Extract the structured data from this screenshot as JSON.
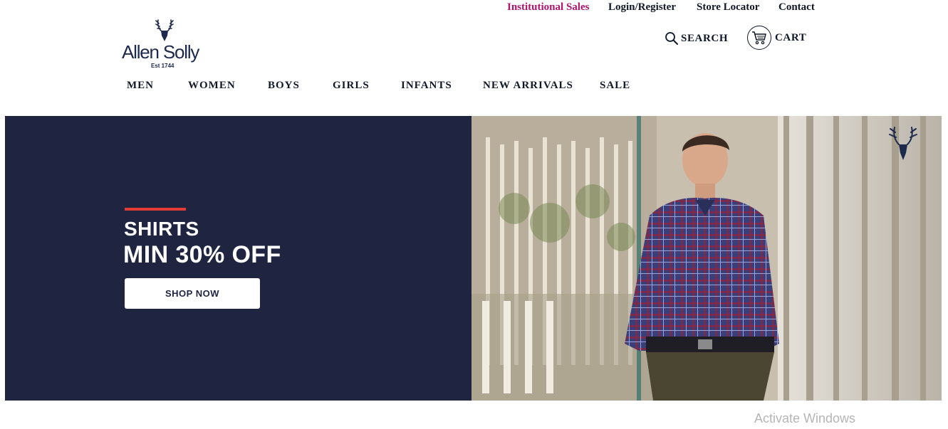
{
  "topbar": {
    "institutional_sales": "Institutional Sales",
    "login": "Login/Register",
    "store_locator": "Store Locator",
    "contact": "Contact",
    "accent_color": "#b0126e"
  },
  "brand": {
    "name": "Allen Solly",
    "est": "Est 1744",
    "logo_icon": "stag-icon"
  },
  "header": {
    "search_label": "SEARCH",
    "cart_label": "CART",
    "search_icon": "search-icon",
    "cart_icon": "cart-icon"
  },
  "nav": {
    "items": [
      "MEN",
      "WOMEN",
      "BOYS",
      "GIRLS",
      "INFANTS",
      "NEW ARRIVALS",
      "SALE"
    ]
  },
  "hero": {
    "line1": "SHIRTS",
    "line2": "MIN 30% OFF",
    "cta": "SHOP NOW",
    "background_color": "#1f2441",
    "accent_rule_color": "#e23a35",
    "image_subject": "model-in-checked-shirt"
  },
  "watermark": "Activate Windows"
}
